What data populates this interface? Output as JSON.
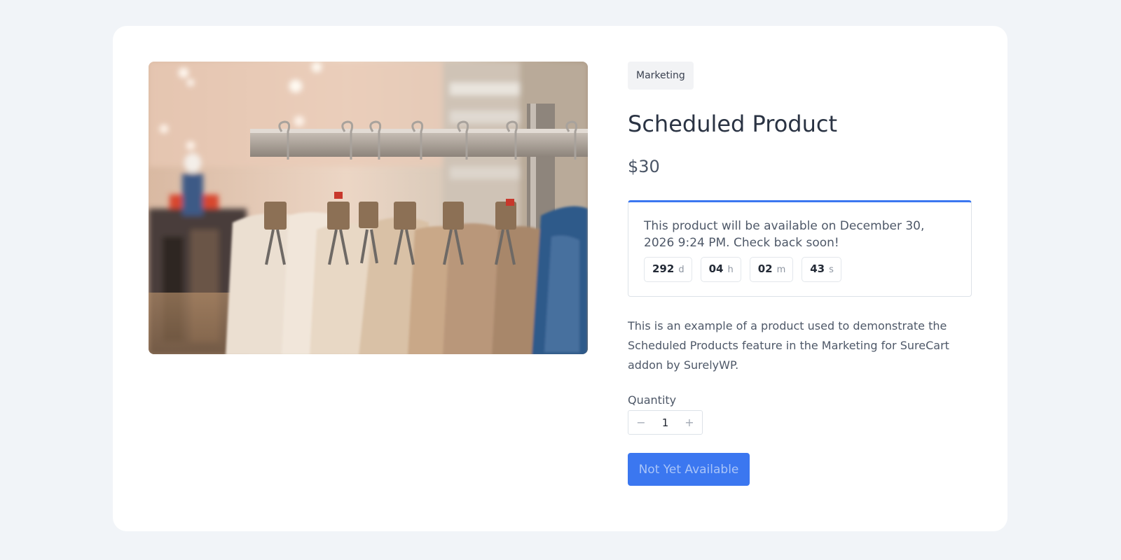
{
  "product": {
    "category_badge": "Marketing",
    "title": "Scheduled Product",
    "price": "$30",
    "image_alt": "Clothing rack with beige and denim garments on hangers",
    "description": "This is an example of a product used to demonstrate the Scheduled Products feature in the Marketing for SureCart addon by SurelyWP."
  },
  "availability": {
    "message": "This product will be available on December 30, 2026 9:24 PM. Check back soon!",
    "countdown": [
      {
        "value": "292",
        "unit": "d"
      },
      {
        "value": "04",
        "unit": "h"
      },
      {
        "value": "02",
        "unit": "m"
      },
      {
        "value": "43",
        "unit": "s"
      }
    ]
  },
  "quantity": {
    "label": "Quantity",
    "value": "1",
    "decrement_icon": "minus-icon",
    "increment_icon": "plus-icon",
    "decrement_glyph": "−",
    "increment_glyph": "+"
  },
  "cta": {
    "label": "Not Yet Available",
    "disabled": true
  },
  "colors": {
    "accent": "#3b77f0",
    "background": "#f1f4f8",
    "card": "#ffffff"
  }
}
